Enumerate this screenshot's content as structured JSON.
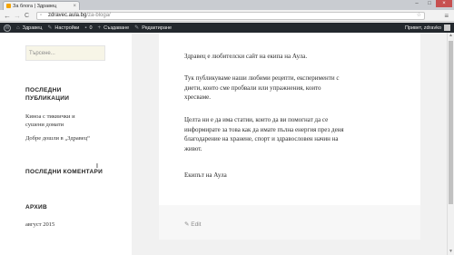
{
  "browser": {
    "tab_title": "За блога | Здравец",
    "tab_close": "×",
    "url_host": "zdravec.aula.bg",
    "url_path": "/za-bloga/",
    "back": "←",
    "forward": "→",
    "reload": "C",
    "star": "☆",
    "menu": "≡",
    "window_buttons": {
      "minimize": "–",
      "maximize": "□",
      "close": "×"
    }
  },
  "adminbar": {
    "wp_logo": "W",
    "site_name": "Здравец",
    "customize": "Настройки",
    "comments_count": "0",
    "new": "Създаване",
    "edit": "Редактиране",
    "greeting": "Привет, zdravko",
    "icons": {
      "site": "home-icon",
      "customize": "brush-icon",
      "comments": "comment-icon",
      "new": "plus-icon",
      "edit": "pencil-icon"
    }
  },
  "sidebar": {
    "search_placeholder": "Търсене...",
    "recent_posts_title": "ПОСЛЕДНИ ПУБЛИКАЦИИ",
    "recent_posts_title_line1": "ПОСЛЕДНИ",
    "recent_posts_title_line2": "ПУБЛИКАЦИИ",
    "recent_posts": [
      {
        "line1": "Киноа с тиквички и",
        "line2": "сушени домати"
      },
      {
        "line1": "Добре дошли в „Здравец“"
      }
    ],
    "recent_comments_title": "ПОСЛЕДНИ КОМЕНТАРИ",
    "archive_title": "АРХИВ",
    "archive_items": [
      "август 2015"
    ]
  },
  "article": {
    "p1": "Здравец е любителски сайт на екипа на Аула.",
    "p2_lines": [
      "Тук публикуваме наши любими рецепти, експерименти с",
      "диети, които сме пробвали или упражнения, които",
      "хресваме."
    ],
    "p3_lines": [
      "Целта ни е да има статии, които да ви помогнат да се",
      "информирате за това как да имате пълна енергия през деня",
      "благодарение на хранене, спорт и здравословен начин на",
      "живот."
    ],
    "signature": "Екипът на Аула",
    "edit_label": "Edit"
  }
}
